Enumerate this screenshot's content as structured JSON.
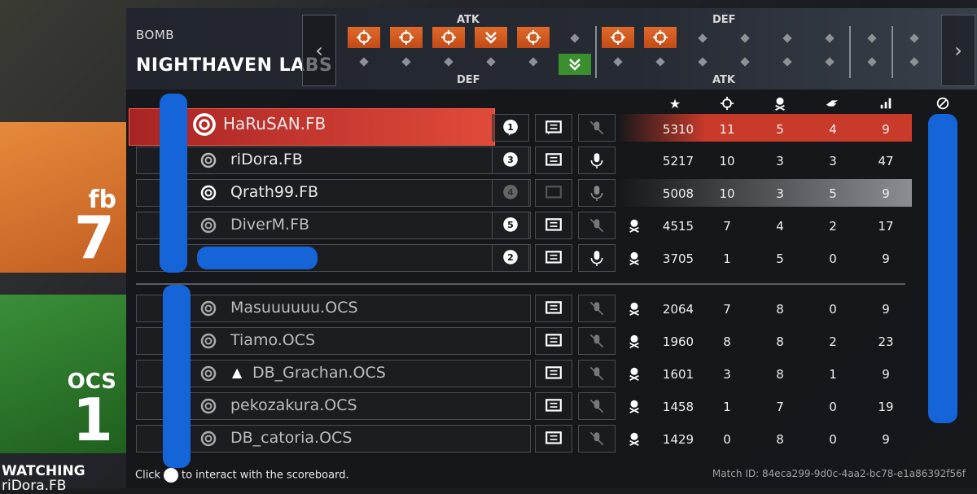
{
  "header": {
    "mode": "BOMB",
    "map": "NIGHTHAVEN LABS",
    "prev_label": "‹",
    "next_label": "›",
    "top_left_side": "ATK",
    "bottom_left_side": "DEF",
    "top_right_side": "DEF",
    "bottom_right_side": "ATK"
  },
  "columns": [
    "star-icon",
    "crosshair-icon",
    "death-skull-icon",
    "assist-hand-icon",
    "ping-bars-icon",
    "mute-toggle-icon"
  ],
  "team1": {
    "abbr": "fb",
    "score": "7",
    "color": "#d56b28",
    "players": [
      {
        "name": "HaRuSAN.FB",
        "badge": "1",
        "score": "5310",
        "kills": "11",
        "deaths": "5",
        "assists": "4",
        "ping": "9"
      },
      {
        "name": "riDora.FB",
        "badge": "3",
        "score": "5217",
        "kills": "10",
        "deaths": "3",
        "assists": "3",
        "ping": "47"
      },
      {
        "name": "Qrath99.FB",
        "badge": "4",
        "score": "5008",
        "kills": "10",
        "deaths": "3",
        "assists": "5",
        "ping": "9"
      },
      {
        "name": "DiverM.FB",
        "badge": "5",
        "score": "4515",
        "kills": "7",
        "deaths": "4",
        "assists": "2",
        "ping": "17"
      },
      {
        "name": "",
        "badge": "2",
        "score": "3705",
        "kills": "1",
        "deaths": "5",
        "assists": "0",
        "ping": "9"
      }
    ]
  },
  "team2": {
    "abbr": "OCS",
    "score": "1",
    "color": "#2f7d2d",
    "players": [
      {
        "name": "Masuuuuuu.OCS",
        "score": "2064",
        "kills": "7",
        "deaths": "8",
        "assists": "0",
        "ping": "9"
      },
      {
        "name": "Tiamo.OCS",
        "score": "1960",
        "kills": "8",
        "deaths": "8",
        "assists": "2",
        "ping": "23"
      },
      {
        "name": "DB_Grachan.OCS",
        "score": "1601",
        "kills": "3",
        "deaths": "8",
        "assists": "1",
        "ping": "9"
      },
      {
        "name": "pekozakura.OCS",
        "score": "1458",
        "kills": "1",
        "deaths": "7",
        "assists": "0",
        "ping": "19"
      },
      {
        "name": "DB_catoria.OCS",
        "score": "1429",
        "kills": "0",
        "deaths": "8",
        "assists": "0",
        "ping": "9"
      }
    ]
  },
  "footer": {
    "click_text": "Click",
    "interact_text": "to interact with the scoreboard.",
    "match_id": "Match ID: 84eca299-9d0c-4aa2-bc78-e1a86392f56f",
    "watching_label": "WATCHING",
    "watching_player": "riDora.FB"
  },
  "colors": {
    "accent": "#e06a2a",
    "highlight_row": "#c83a2a",
    "green": "#3b8f2e"
  }
}
